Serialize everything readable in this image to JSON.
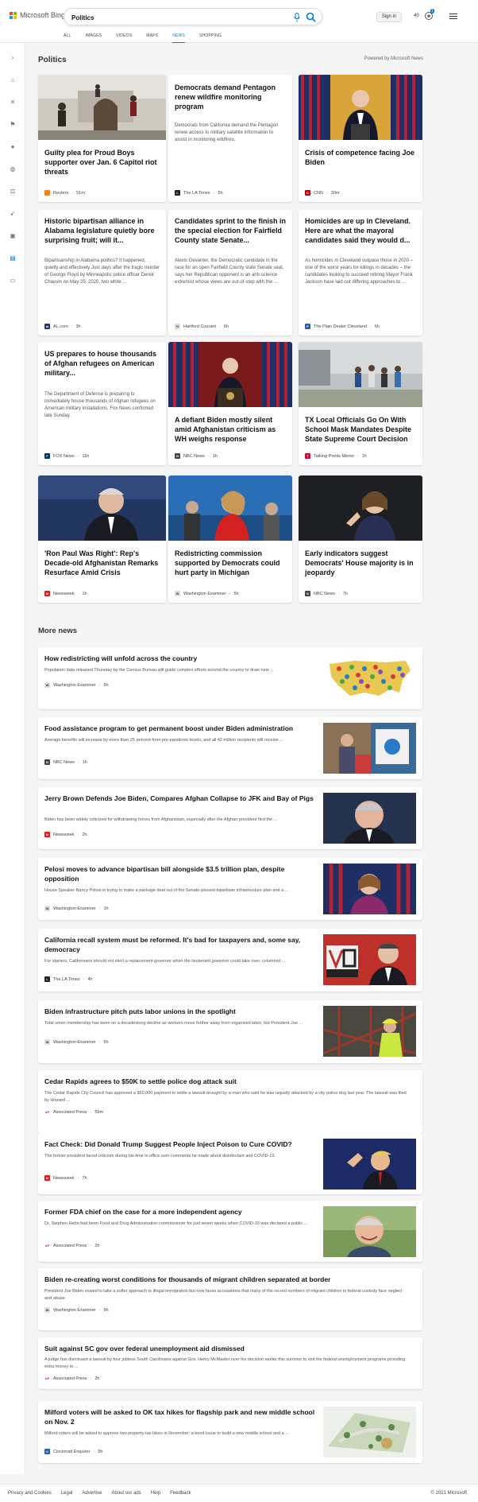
{
  "header": {
    "brand": "Microsoft Bing",
    "search_value": "Politics",
    "signin_label": "Sign in",
    "points": "40",
    "rewards_badge": "1",
    "nav_tabs": [
      "ALL",
      "IMAGES",
      "VIDEOS",
      "MAPS",
      "NEWS",
      "SHOPPING"
    ],
    "active_tab": "NEWS"
  },
  "colors": {
    "accent": "#0078d4",
    "ms_red": "#f25022",
    "ms_green": "#7fba00",
    "ms_blue": "#00a4ef",
    "ms_yellow": "#ffb900"
  },
  "sidebar_icons": [
    "chevron-right-icon",
    "home-icon",
    "explore-icon",
    "flag-icon",
    "location-icon",
    "globe-icon",
    "scale-icon",
    "rocket-icon",
    "movie-icon",
    "politics-icon",
    "money-icon"
  ],
  "main": {
    "section_title": "Politics",
    "powered_by": "Powered by Microsoft News",
    "top_cards": [
      {
        "headline": "Guilty plea for Proud Boys supporter over Jan. 6 Capitol riot threats",
        "abstract": "",
        "source": "Reuters",
        "time": "51m",
        "image": "capitol-riot-photo"
      },
      {
        "headline": "Democrats demand Pentagon renew wildfire monitoring program",
        "abstract": "Democrats from California demand the Pentagon renew access to military satellite information to assist in monitoring wildfires.",
        "source": "The LA Times",
        "time": "5h",
        "image": ""
      },
      {
        "headline": "Crisis of competence facing Joe Biden",
        "abstract": "",
        "source": "CNN",
        "time": "30m",
        "image": "biden-flags-photo"
      },
      {
        "headline": "Historic bipartisan alliance in Alabama legislature quietly bore surprising fruit; will it...",
        "abstract": "Bipartisanship in Alabama politics? It happened, quietly and effectively Just days after the tragic murder of George Floyd by Minneapolis police officer Derek Chauvin on May 25, 2020, two white ...",
        "source": "AL.com",
        "time": "3h",
        "image": ""
      },
      {
        "headline": "Candidates sprint to the finish in the special election for Fairfield County state Senate...",
        "abstract": "Alexis Gevanter, the Democratic candidate in the race for an open Fairfield County state Senate seat, says her Republican opponent is an anti-science extremist whose views are out-of-step with the ...",
        "source": "Hartford Courant",
        "time": "6h",
        "image": ""
      },
      {
        "headline": "Homicides are up in Cleveland. Here are what the mayoral candidates said they would d...",
        "abstract": "As homicides in Cleveland outpace those in 2020 – one of the worst years for killings in decades – the candidates looking to succeed retiring Mayor Frank Jackson have laid out differing approaches to ...",
        "source": "The Plain Dealer Cleveland",
        "time": "6h",
        "image": ""
      },
      {
        "headline": "US prepares to house thousands of Afghan refugees on American military...",
        "abstract": "The Department of Defense is preparing to immediately house thousands of Afghan refugees on American military installations, Fox News confirmed late Sunday.",
        "source": "FOX News",
        "time": "11h",
        "image": ""
      },
      {
        "headline": "A defiant Biden mostly silent amid Afghanistan criticism as WH weighs response",
        "abstract": "",
        "source": "NBC News",
        "time": "1h",
        "image": "biden-podium-photo"
      },
      {
        "headline": "TX Local Officials Go On With School Mask Mandates Despite State Supreme Court Decision",
        "abstract": "",
        "source": "Talking Points Memo",
        "time": "1h",
        "image": "school-kids-photo"
      },
      {
        "headline": "'Ron Paul Was Right': Rep's Decade-old Afghanistan Remarks Resurface Amid Crisis",
        "abstract": "",
        "source": "Newsweek",
        "time": "1h",
        "image": "ron-paul-photo"
      },
      {
        "headline": "Redistricting commission supported by Democrats could hurt party in Michigan",
        "abstract": "",
        "source": "Washington Examiner",
        "time": "5h",
        "image": "commission-photo"
      },
      {
        "headline": "Early indicators suggest Democrats' House majority is in jeopardy",
        "abstract": "",
        "source": "NBC News",
        "time": "7h",
        "image": "pelosi-photo"
      }
    ],
    "more_title": "More news",
    "more_news": [
      {
        "headline": "How redistricting will unfold across the country",
        "abstract": "Population data released Thursday by the Census Bureau will guide complex efforts around the country to draw new ...",
        "source": "Washington Examiner",
        "time": "5h",
        "image": "us-map-photo"
      },
      {
        "headline": "Food assistance program to get permanent boost under Biden administration",
        "abstract": "Average benefits will increase by more than 25 percent from pre-pandemic levels, and all 42 million recipients will receive ...",
        "source": "NBC News",
        "time": "1h",
        "image": "grocery-photo"
      },
      {
        "headline": "Jerry Brown Defends Joe Biden, Compares Afghan Collapse to JFK and Bay of Pigs",
        "abstract": "Biden has been widely criticized for withdrawing forces from Afghanistan, especially after the Afghan president fled the ...",
        "source": "Newsweek",
        "time": "2h",
        "image": "jerry-brown-photo"
      },
      {
        "headline": "Pelosi moves to advance bipartisan bill alongside $3.5 trillion plan, despite opposition",
        "abstract": "House Speaker Nancy Pelosi is trying to make a package deal out of the Senate-passed bipartisan infrastructure plan and a ...",
        "source": "Washington Examiner",
        "time": "1h",
        "image": "pelosi-flags-photo"
      },
      {
        "headline": "California recall system must be reformed. It's bad for taxpayers and, some say, democracy",
        "abstract": "For starters, Californians should not elect a replacement governor when the lieutenant governor could take over, columnist ...",
        "source": "The LA Times",
        "time": "4h",
        "image": "newsom-vote-photo"
      },
      {
        "headline": "Biden infrastructure pitch puts labor unions in the spotlight",
        "abstract": "Total union membership has been on a decadeslong decline as workers move further away from organized labor, but President Joe ...",
        "source": "Washington Examiner",
        "time": "5h",
        "image": "construction-worker-photo"
      },
      {
        "headline": "Cedar Rapids agrees to $50K to settle police dog attack suit",
        "abstract": "The Cedar Rapids City Council has approved a $50,000 payment to settle a lawsuit brought by a man who said he was unjustly attacked by a city police dog last year. The lawsuit was filed by Howard ...",
        "source": "Associated Press",
        "time": "59m",
        "image": ""
      },
      {
        "headline": "Fact Check: Did Donald Trump Suggest People Inject Poison to Cure COVID?",
        "abstract": "The former president faced criticism during his time in office over comments he made about disinfectant and COVID-19.",
        "source": "Newsweek",
        "time": "7h",
        "image": "trump-photo"
      },
      {
        "headline": "Former FDA chief on the case for a more independent agency",
        "abstract": "Dr. Stephen Hahn had been Food and Drug Administration commissioner for just seven weeks when COVID-19 was declared a public ...",
        "source": "Associated Press",
        "time": "2h",
        "image": "hahn-photo"
      },
      {
        "headline": "Biden re-creating worst conditions for thousands of migrant children separated at border",
        "abstract": "President Joe Biden vowed to take a softer approach to illegal immigration but now faces accusations that many of the record numbers of migrant children in federal custody face neglect and abuse.",
        "source": "Washington Examiner",
        "time": "5h",
        "image": ""
      },
      {
        "headline": "Suit against SC gov over federal unemployment aid dismissed",
        "abstract": "A judge has dismissed a lawsuit by four jobless South Carolinians against Gov. Henry McMaster over his decision earlier this summer to exit the federal unemployment programs providing extra money to ...",
        "source": "Associated Press",
        "time": "2h",
        "image": ""
      },
      {
        "headline": "Milford voters will be asked to OK tax hikes for flagship park and new middle school on Nov. 2",
        "abstract": "Milford voters will be asked to approve two property-tax hikes in November: a bond issue to build a new middle school and a ...",
        "source": "Cincinnati Enquirer",
        "time": "5h",
        "image": "park-plan-photo"
      }
    ]
  },
  "footer": {
    "links": [
      "Privacy and Cookies",
      "Legal",
      "Advertise",
      "About our ads",
      "Help",
      "Feedback"
    ],
    "copyright": "© 2021 Microsoft"
  }
}
